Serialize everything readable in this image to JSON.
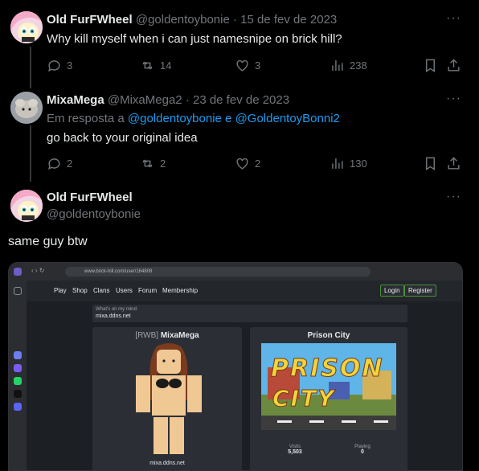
{
  "tweets": [
    {
      "name": "Old FurFWheel",
      "handle": "@goldentoybonie",
      "date": "· 15 de fev de 2023",
      "text": "Why kill myself when i can just namesnipe on brick hill?",
      "replies": "3",
      "retweets": "14",
      "likes": "3",
      "views": "238"
    },
    {
      "name": "MixaMega",
      "handle": "@MixaMega2",
      "date": "· 23 de fev de 2023",
      "reply_prefix": "Em resposta a",
      "reply_user1": "@goldentoybonie",
      "reply_and": "e",
      "reply_user2": "@GoldentoyBonni2",
      "text": "go back to your original idea",
      "replies": "2",
      "retweets": "2",
      "likes": "2",
      "views": "130"
    },
    {
      "name": "Old FurFWheel",
      "handle": "@goldentoybonie",
      "text": "same guy btw"
    }
  ],
  "more_label": "···",
  "embedded_screenshot": {
    "url": "www.brick-hill.com/user/164808",
    "nav": [
      "Play",
      "Shop",
      "Clans",
      "Users",
      "Forum",
      "Membership"
    ],
    "login": "Login",
    "register": "Register",
    "status_label": "What's on my mind:",
    "status_value": "mixa.ddns.net",
    "rank": "[RWB]",
    "username": "MixaMega",
    "profile_status": "mixa.ddns.net",
    "game_title": "Prison City",
    "game_logo_line1": "PRISON",
    "game_logo_line2": "CITY",
    "visits_label": "Visits",
    "visits_value": "5,503",
    "playing_label": "Playing",
    "playing_value": "0"
  },
  "colors": {
    "background": "#000000",
    "text": "#e7e9ea",
    "muted": "#71767b",
    "link": "#1d9bf0",
    "divider": "#2f3336"
  }
}
